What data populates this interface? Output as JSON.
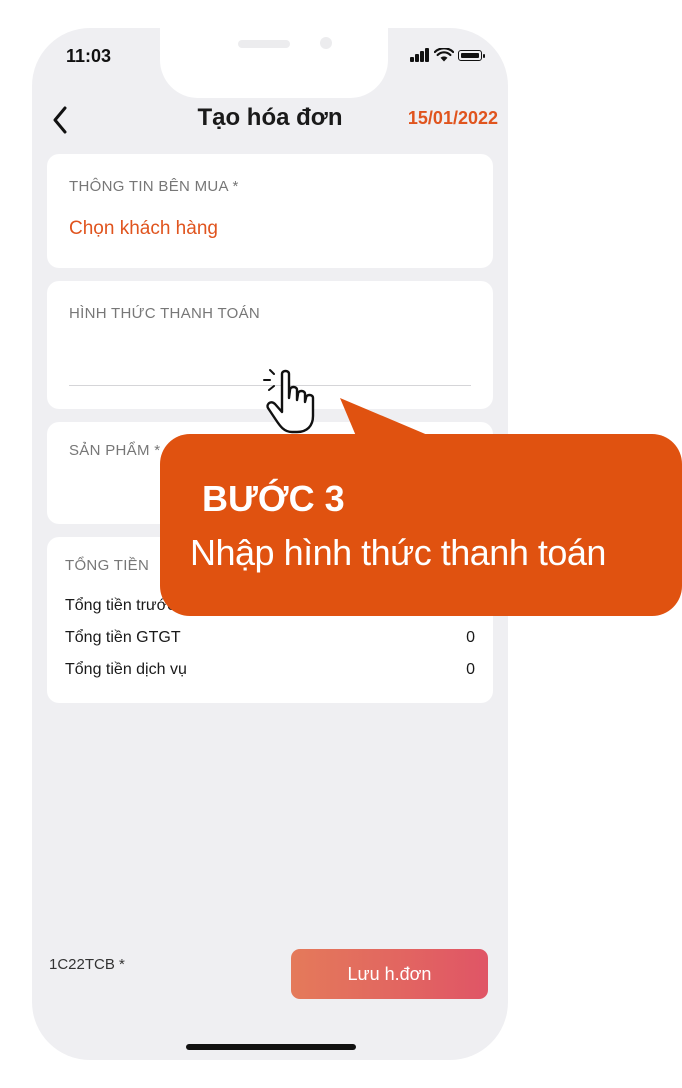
{
  "status_bar": {
    "time": "11:03"
  },
  "header": {
    "title": "Tạo hóa đơn",
    "date": "15/01/2022",
    "back_icon": "chevron-left-icon"
  },
  "buyer": {
    "label": "THÔNG TIN BÊN MUA *",
    "action": "Chọn khách hàng"
  },
  "payment": {
    "label": "HÌNH THỨC THANH TOÁN",
    "value": ""
  },
  "products": {
    "label": "SẢN PHẨM *"
  },
  "totals": {
    "label": "TỔNG TIỀN",
    "rows": [
      {
        "label": "Tổng tiền trước",
        "value": ""
      },
      {
        "label": "Tổng tiền GTGT",
        "value": "0"
      },
      {
        "label": "Tổng tiền dịch vụ",
        "value": "0"
      }
    ]
  },
  "footer": {
    "serial": "1C22TCB *",
    "save_label": "Lưu h.đơn"
  },
  "callout": {
    "step": "BƯỚC 3",
    "description": "Nhập hình thức thanh toán"
  },
  "colors": {
    "accent": "#e0541e",
    "callout": "#e05210",
    "background": "#efeff2"
  }
}
